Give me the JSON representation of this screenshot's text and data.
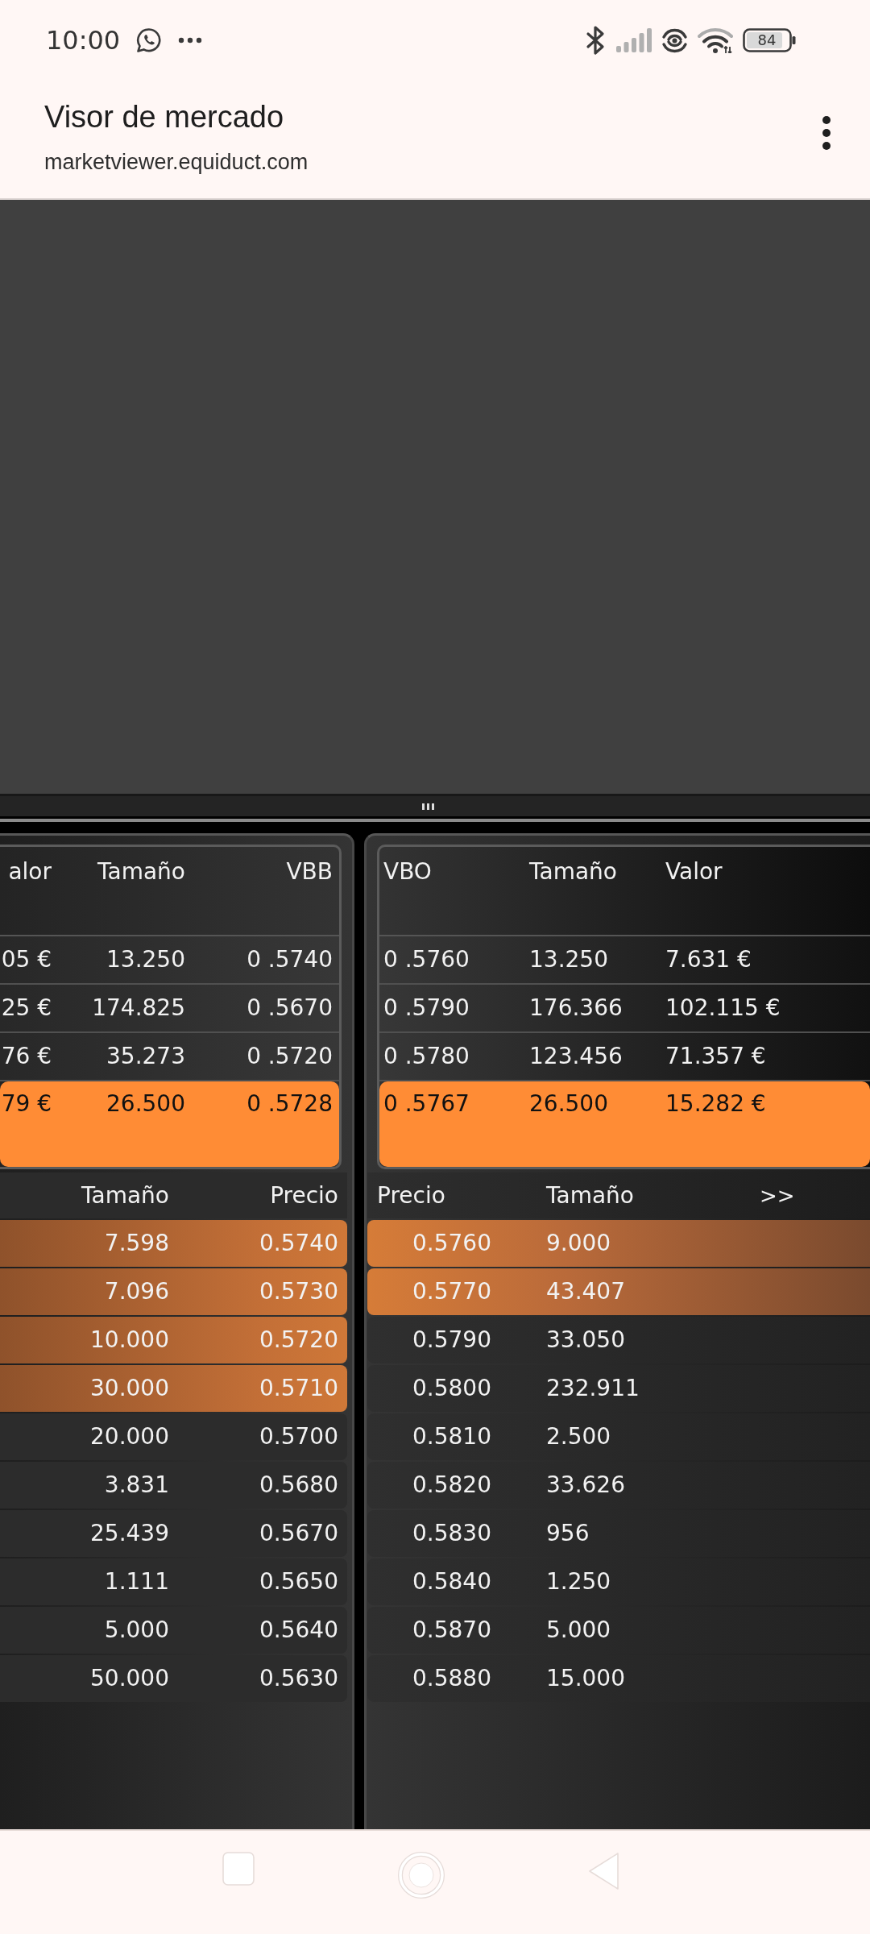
{
  "status_bar": {
    "time": "10:00",
    "battery": "84"
  },
  "header": {
    "title": "Visor de mercado",
    "url": "marketviewer.equiduct.com"
  },
  "left_summary": {
    "columns": [
      "alor",
      "Tamaño",
      "VBB"
    ],
    "rows": [
      {
        "cells": [
          "05 €",
          "13.250",
          "0 .5740"
        ],
        "highlighted": false
      },
      {
        "cells": [
          "25 €",
          "174.825",
          "0 .5670"
        ],
        "highlighted": false
      },
      {
        "cells": [
          "76 €",
          "35.273",
          "0 .5720"
        ],
        "highlighted": false
      },
      {
        "cells": [
          "79 €",
          "26.500",
          "0 .5728"
        ],
        "highlighted": true
      }
    ]
  },
  "right_summary": {
    "columns": [
      "VBO",
      "Tamaño",
      "Valor"
    ],
    "rows": [
      {
        "cells": [
          "0 .5760",
          "13.250",
          "7.631 €"
        ],
        "highlighted": false
      },
      {
        "cells": [
          "0 .5790",
          "176.366",
          "102.115 €"
        ],
        "highlighted": false
      },
      {
        "cells": [
          "0 .5780",
          "123.456",
          "71.357 €"
        ],
        "highlighted": false
      },
      {
        "cells": [
          "0 .5767",
          "26.500",
          "15.282 €"
        ],
        "highlighted": true
      }
    ]
  },
  "left_book": {
    "columns": [
      "Tamaño",
      "Precio"
    ],
    "rows": [
      {
        "cells": [
          "7.598",
          "0.5740"
        ],
        "highlighted": true
      },
      {
        "cells": [
          "7.096",
          "0.5730"
        ],
        "highlighted": true
      },
      {
        "cells": [
          "10.000",
          "0.5720"
        ],
        "highlighted": true
      },
      {
        "cells": [
          "30.000",
          "0.5710"
        ],
        "highlighted": true
      },
      {
        "cells": [
          "20.000",
          "0.5700"
        ],
        "highlighted": false
      },
      {
        "cells": [
          "3.831",
          "0.5680"
        ],
        "highlighted": false
      },
      {
        "cells": [
          "25.439",
          "0.5670"
        ],
        "highlighted": false
      },
      {
        "cells": [
          "1.111",
          "0.5650"
        ],
        "highlighted": false
      },
      {
        "cells": [
          "5.000",
          "0.5640"
        ],
        "highlighted": false
      },
      {
        "cells": [
          "50.000",
          "0.5630"
        ],
        "highlighted": false
      }
    ]
  },
  "right_book": {
    "columns": [
      "Precio",
      "Tamaño"
    ],
    "expand_button": ">>",
    "rows": [
      {
        "cells": [
          "0.5760",
          "9.000"
        ],
        "highlighted": true
      },
      {
        "cells": [
          "0.5770",
          "43.407"
        ],
        "highlighted": true
      },
      {
        "cells": [
          "0.5790",
          "33.050"
        ],
        "highlighted": false
      },
      {
        "cells": [
          "0.5800",
          "232.911"
        ],
        "highlighted": false
      },
      {
        "cells": [
          "0.5810",
          "2.500"
        ],
        "highlighted": false
      },
      {
        "cells": [
          "0.5820",
          "33.626"
        ],
        "highlighted": false
      },
      {
        "cells": [
          "0.5830",
          "956"
        ],
        "highlighted": false
      },
      {
        "cells": [
          "0.5840",
          "1.250"
        ],
        "highlighted": false
      },
      {
        "cells": [
          "0.5870",
          "5.000"
        ],
        "highlighted": false
      },
      {
        "cells": [
          "0.5880",
          "15.000"
        ],
        "highlighted": false
      }
    ]
  }
}
